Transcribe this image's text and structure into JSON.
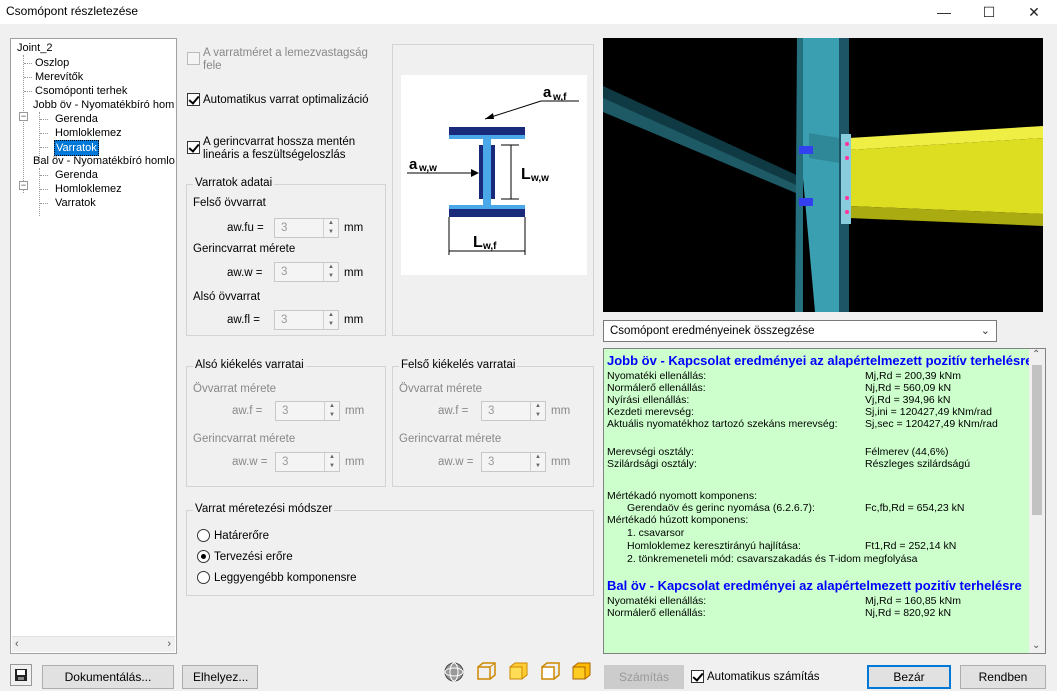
{
  "window": {
    "title": "Csomópont részletezése",
    "minimize": "—",
    "maximize": "☐",
    "close": "✕"
  },
  "tree": {
    "root": "Joint_2",
    "items": [
      {
        "label": "Oszlop"
      },
      {
        "label": "Merevítők"
      },
      {
        "label": "Csomóponti terhek"
      },
      {
        "label": "Jobb öv - Nyomatékbíró hom"
      },
      {
        "label": "Gerenda"
      },
      {
        "label": "Homloklemez"
      },
      {
        "label": "Varratok"
      },
      {
        "label": "Bal öv - Nyomatékbíró homlo"
      },
      {
        "label": "Gerenda"
      },
      {
        "label": "Homloklemez"
      },
      {
        "label": "Varratok"
      }
    ]
  },
  "options": {
    "half_thickness": "A varratméret a lemezvastagság fele",
    "half_thickness_l1": "A varratméret a lemezvastagság",
    "half_thickness_l2": "fele",
    "auto_opt": "Automatikus varrat optimalizáció",
    "linear_l1": "A gerincvarrat hossza mentén",
    "linear_l2": "lineáris a feszültségeloszlás"
  },
  "weld_data": {
    "title": "Varratok adatai",
    "upper_flange": "Felső övvarrat",
    "aw_fu_label": "aw.fu =",
    "aw_fu": "3",
    "web_size": "Gerincvarrat mérete",
    "aw_w_label": "aw.w =",
    "aw_w": "3",
    "lower_flange": "Alsó övvarrat",
    "aw_fl_label": "aw.fl =",
    "aw_fl": "3",
    "unit": "mm"
  },
  "diagram": {
    "a_wf": "a",
    "a_wf_sub": "w,f",
    "a_ww": "a",
    "a_ww_sub": "w,w",
    "l_ww": "L",
    "l_ww_sub": "w,w",
    "l_wf": "L",
    "l_wf_sub": "w,f"
  },
  "lower_haunch": {
    "title": "Alsó kiékelés varratai",
    "flange": "Övvarrat mérete",
    "aw_f_label": "aw.f =",
    "aw_f": "3",
    "web": "Gerincvarrat mérete",
    "aw_w_label": "aw.w =",
    "aw_w": "3",
    "unit": "mm"
  },
  "upper_haunch": {
    "title": "Felső kiékelés varratai",
    "flange": "Övvarrat mérete",
    "aw_f_label": "aw.f =",
    "aw_f": "3",
    "web": "Gerincvarrat mérete",
    "aw_w_label": "aw.w =",
    "aw_w": "3",
    "unit": "mm"
  },
  "sizing": {
    "title": "Varrat méretezési módszer",
    "opt1": "Határerőre",
    "opt2": "Tervezési erőre",
    "opt3": "Leggyengébb komponensre",
    "selected": 2
  },
  "results_combo": "Csomópont eredményeinek összegzése",
  "results": {
    "right_head": "Jobb öv - Kapcsolat eredményei az alapértelmezett pozitív terhelésre",
    "rows": [
      {
        "l": "Nyomatéki ellenállás:",
        "v": "Mj,Rd = 200,39 kNm"
      },
      {
        "l": "Normálerő ellenállás:",
        "v": "Nj,Rd = 560,09 kN"
      },
      {
        "l": "Nyírási ellenállás:",
        "v": "Vj,Rd = 394,96 kN"
      },
      {
        "l": "Kezdeti merevség:",
        "v": "Sj,ini = 120427,49 kNm/rad"
      },
      {
        "l": "Aktuális nyomatékhoz tartozó szekáns merevség:",
        "v": "Sj,sec = 120427,49 kNm/rad"
      }
    ],
    "stiff_class_l": "Merevségi osztály:",
    "stiff_class_v": "Félmerev (44,6%)",
    "str_class_l": "Szilárdsági osztály:",
    "str_class_v": "Részleges szilárdságú",
    "comp_head": "Mértékadó nyomott komponens:",
    "comp_l": "Gerendaöv és gerinc nyomása (6.2.6.7):",
    "comp_v": "Fc,fb,Rd = 654,23 kN",
    "tens_head": "Mértékadó húzott komponens:",
    "tens_1": "1. csavarsor",
    "tens_l": "Homloklemez keresztirányú hajlítása:",
    "tens_v": "Ft1,Rd = 252,14 kN",
    "tens_2": "2. tönkremeneteli mód: csavarszakadás és T-idom megfolyása",
    "left_head": "Bal öv - Kapcsolat eredményei az alapértelmezett pozitív terhelésre",
    "rows2": [
      {
        "l": "Nyomatéki ellenállás:",
        "v": "Mj,Rd = 160,85 kNm"
      },
      {
        "l": "Normálerő ellenállás:",
        "v": "Nj,Rd = 820,92 kN"
      }
    ]
  },
  "buttons": {
    "document": "Dokumentálás...",
    "place": "Elhelyez...",
    "calc": "Számítás",
    "auto_calc": "Automatikus számítás",
    "close": "Bezár",
    "ok": "Rendben"
  },
  "colors": {
    "accent": "#0078d7",
    "results_bg": "#ccffcc",
    "results_head": "#0000ff",
    "steel": "#3399aa",
    "beam": "#dddd22"
  }
}
